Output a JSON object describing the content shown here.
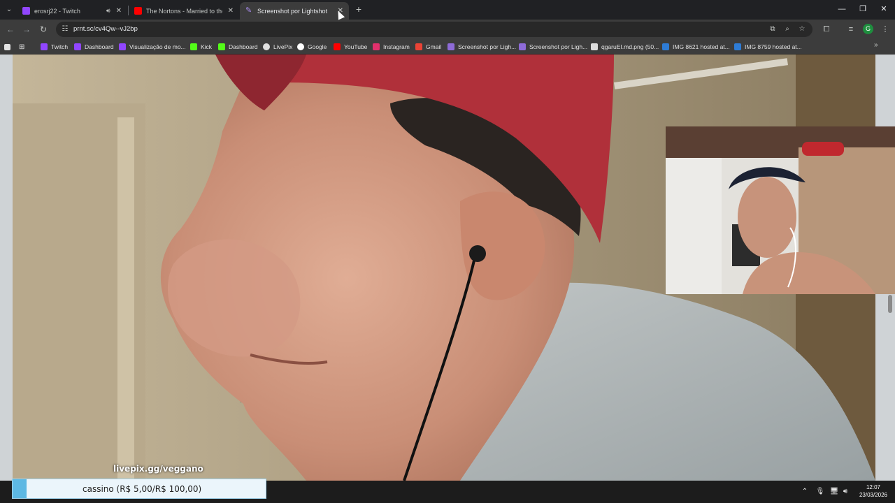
{
  "tabs": [
    {
      "title": "erosrj22 - Twitch",
      "favicon": "twitch-icon",
      "color": "#9146ff",
      "active": false,
      "audio": true
    },
    {
      "title": "The Nortons - Married to the Bl",
      "favicon": "youtube-icon",
      "color": "#ff0000",
      "active": false,
      "audio": false
    },
    {
      "title": "Screenshot por Lightshot",
      "favicon": "lightshot-icon",
      "color": "#8e6bd8",
      "active": true,
      "audio": false
    }
  ],
  "address_bar": {
    "url": "prnt.sc/cv4Qw--vJ2bp"
  },
  "profile_initial": "G",
  "bookmarks": [
    {
      "label": "Twitch",
      "icon": "twitch-icon",
      "color": "#9146ff"
    },
    {
      "label": "Dashboard",
      "icon": "twitch-icon",
      "color": "#9146ff"
    },
    {
      "label": "Visualização de mo...",
      "icon": "twitch-icon",
      "color": "#9146ff"
    },
    {
      "label": "Kick",
      "icon": "kick-icon",
      "color": "#53fc18"
    },
    {
      "label": "Dashboard",
      "icon": "kick-icon",
      "color": "#53fc18"
    },
    {
      "label": "LivePix",
      "icon": "livepix-icon",
      "color": "#e0e0e0"
    },
    {
      "label": "Google",
      "icon": "google-icon",
      "color": "#ffffff"
    },
    {
      "label": "YouTube",
      "icon": "youtube-icon",
      "color": "#ff0000"
    },
    {
      "label": "Instagram",
      "icon": "instagram-icon",
      "color": "#e1306c"
    },
    {
      "label": "Gmail",
      "icon": "gmail-icon",
      "color": "#ea4335"
    },
    {
      "label": "Screenshot por Ligh...",
      "icon": "lightshot-icon",
      "color": "#8e6bd8"
    },
    {
      "label": "Screenshot por Ligh...",
      "icon": "lightshot-icon",
      "color": "#8e6bd8"
    },
    {
      "label": "qgaruEI.md.png (50...",
      "icon": "image-icon",
      "color": "#dddddd"
    },
    {
      "label": "IMG 8621 hosted at...",
      "icon": "imgbb-icon",
      "color": "#2e7cd6"
    },
    {
      "label": "IMG 8759 hosted at...",
      "icon": "imgbb-icon",
      "color": "#2e7cd6"
    }
  ],
  "stream_overlay": {
    "livepix_text": "livepix.gg/veggano",
    "alert_text": "cassino (R$ 5,00/R$ 100,00)"
  },
  "taskbar": {
    "time": "12:07",
    "date": "23/03/2026"
  }
}
